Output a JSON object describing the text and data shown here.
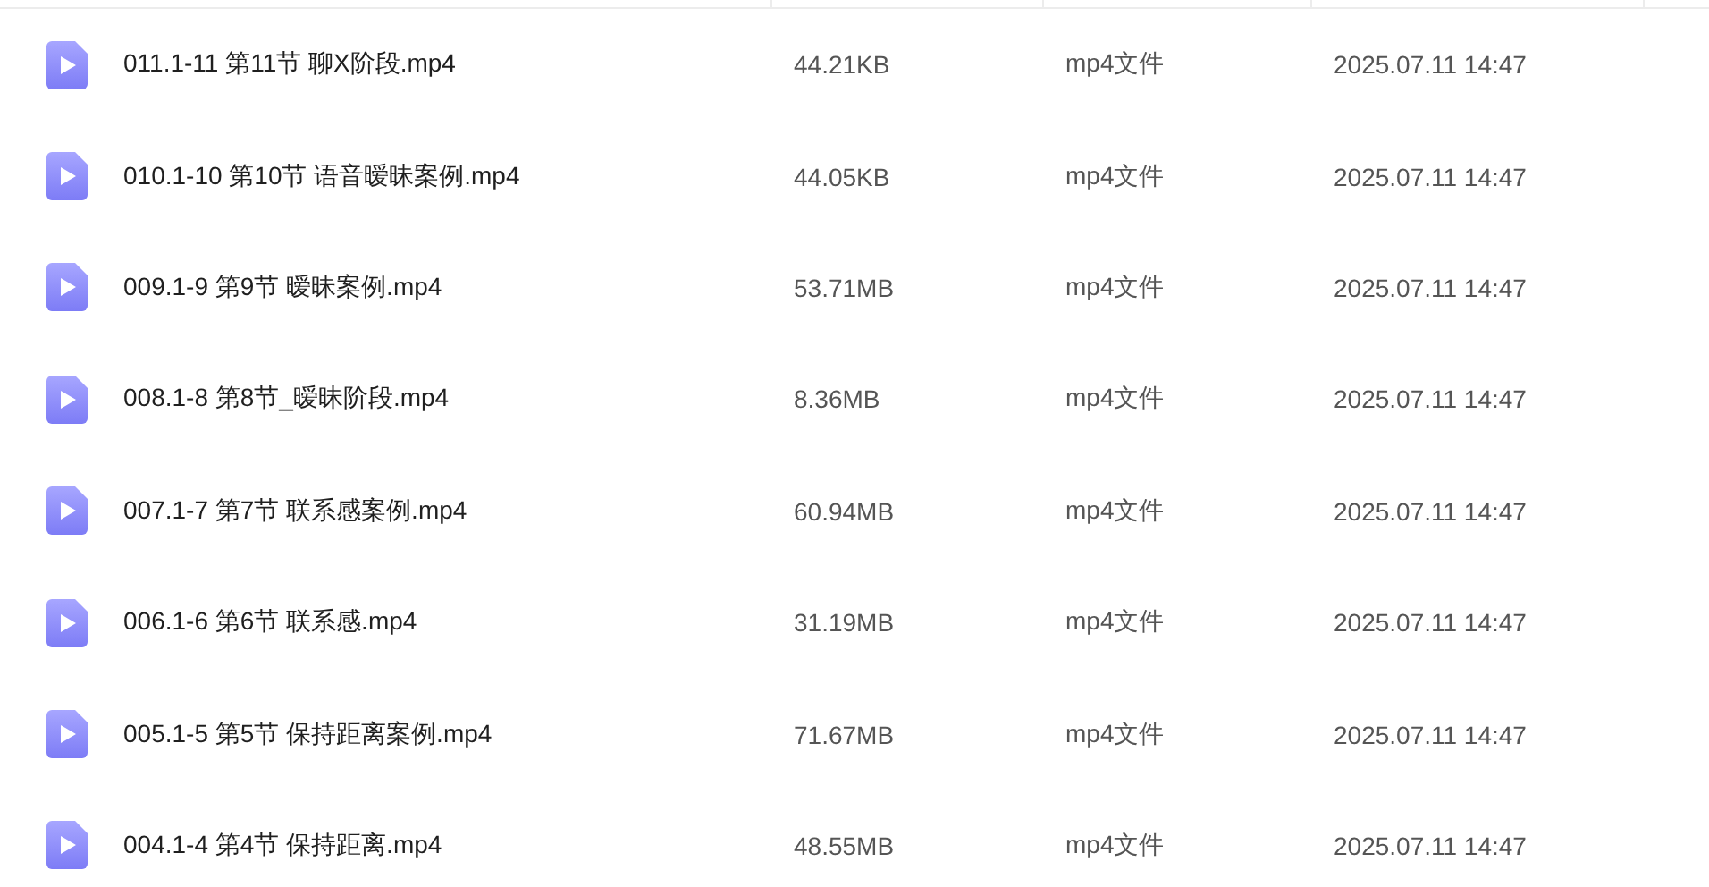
{
  "files": [
    {
      "name": "011.1-11 第11节 聊X阶段.mp4",
      "size": "44.21KB",
      "type": "mp4文件",
      "modified": "2025.07.11 14:47"
    },
    {
      "name": "010.1-10 第10节 语音暧昧案例.mp4",
      "size": "44.05KB",
      "type": "mp4文件",
      "modified": "2025.07.11 14:47"
    },
    {
      "name": "009.1-9 第9节 暧昧案例.mp4",
      "size": "53.71MB",
      "type": "mp4文件",
      "modified": "2025.07.11 14:47"
    },
    {
      "name": "008.1-8 第8节_暧昧阶段.mp4",
      "size": "8.36MB",
      "type": "mp4文件",
      "modified": "2025.07.11 14:47"
    },
    {
      "name": "007.1-7 第7节 联系感案例.mp4",
      "size": "60.94MB",
      "type": "mp4文件",
      "modified": "2025.07.11 14:47"
    },
    {
      "name": "006.1-6 第6节 联系感.mp4",
      "size": "31.19MB",
      "type": "mp4文件",
      "modified": "2025.07.11 14:47"
    },
    {
      "name": "005.1-5 第5节 保持距离案例.mp4",
      "size": "71.67MB",
      "type": "mp4文件",
      "modified": "2025.07.11 14:47"
    },
    {
      "name": "004.1-4 第4节 保持距离.mp4",
      "size": "48.55MB",
      "type": "mp4文件",
      "modified": "2025.07.11 14:47"
    }
  ]
}
